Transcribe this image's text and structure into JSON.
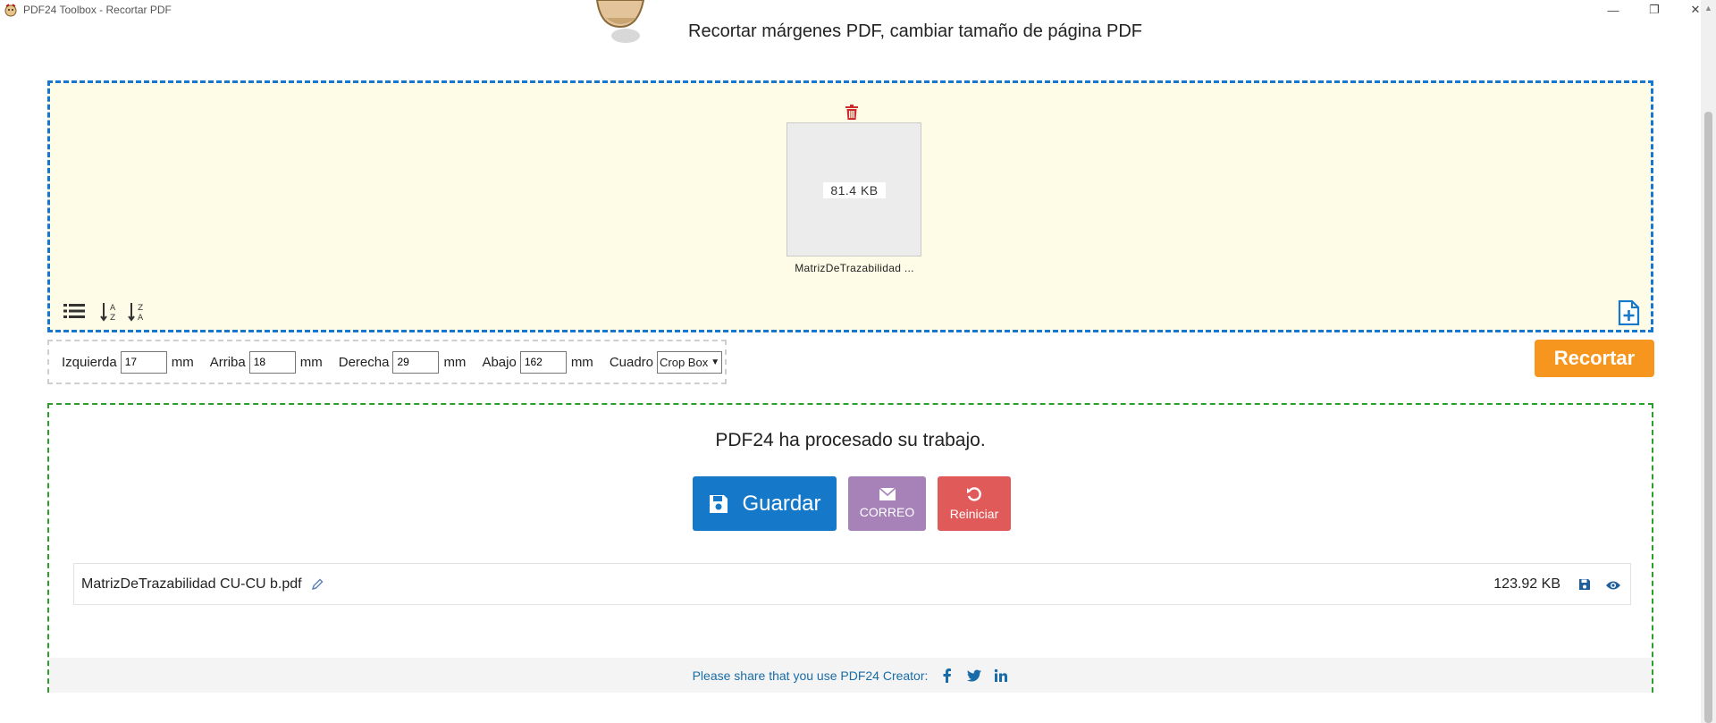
{
  "window": {
    "title": "PDF24 Toolbox - Recortar PDF",
    "controls": [
      "minimize",
      "maximize",
      "close"
    ]
  },
  "header": {
    "title": "Recortar márgenes PDF, cambiar tamaño de página PDF"
  },
  "dropzone": {
    "file": {
      "size": "81.4 KB",
      "name": "MatrizDeTrazabilidad ..."
    },
    "icons": [
      "trash-icon",
      "list-view-icon",
      "sort-az-icon",
      "sort-za-icon",
      "add-file-icon"
    ]
  },
  "options": {
    "left_label": "Izquierda",
    "left_value": "17",
    "top_label": "Arriba",
    "top_value": "18",
    "right_label": "Derecha",
    "right_value": "29",
    "bottom_label": "Abajo",
    "bottom_value": "162",
    "unit": "mm",
    "box_label": "Cuadro",
    "box_value": "Crop Box"
  },
  "crop_button": "Recortar",
  "result": {
    "message": "PDF24 ha procesado su trabajo.",
    "save_label": "Guardar",
    "mail_label": "CORREO",
    "reset_label": "Reiniciar",
    "file_name": "MatrizDeTrazabilidad CU-CU b.pdf",
    "file_size": "123.92 KB",
    "share_text": "Please share that you use PDF24 Creator:"
  },
  "colors": {
    "accent_blue": "#1678c8",
    "orange": "#f7961e",
    "mail": "#a682b8",
    "reset": "#e15a5a",
    "dropzone_bg": "#fefbe6",
    "success_border": "#2aa02a"
  }
}
